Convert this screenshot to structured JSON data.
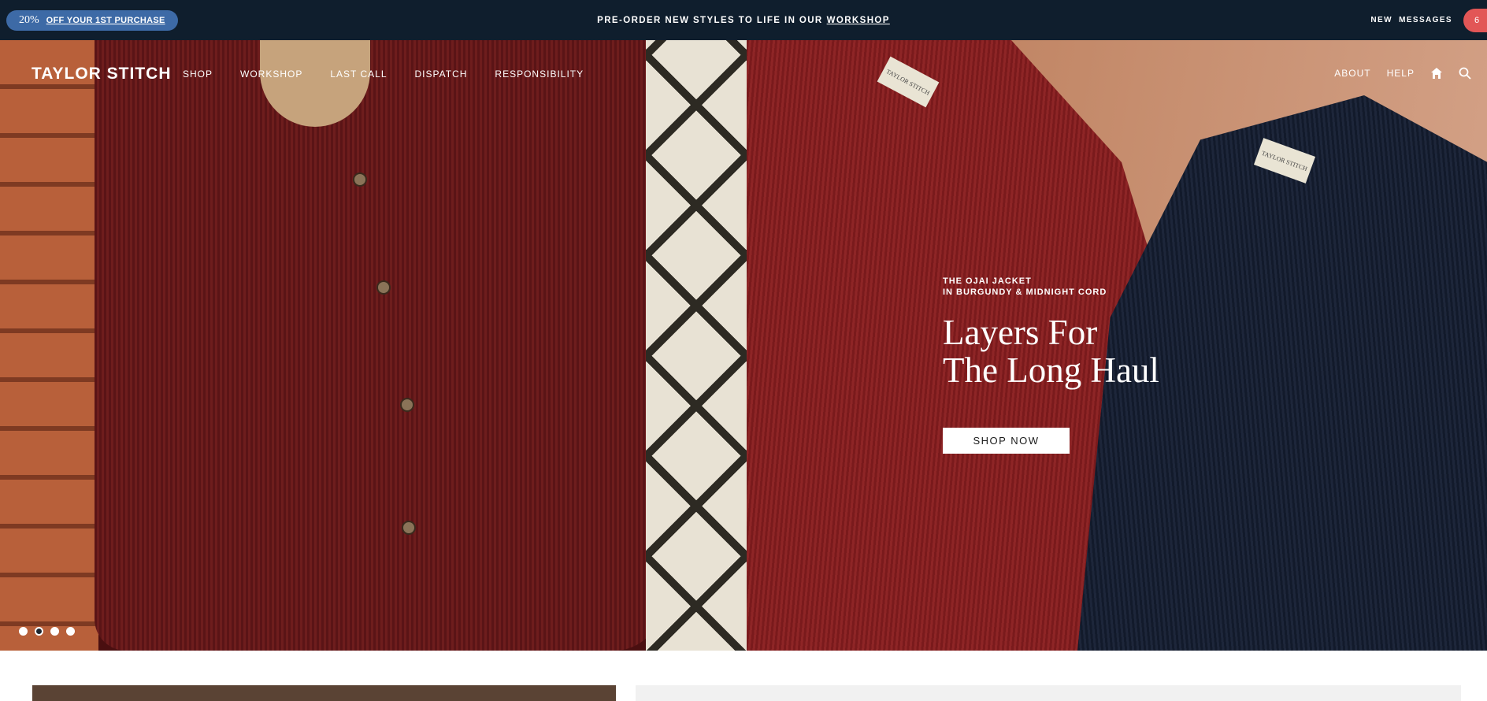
{
  "promo": {
    "percent": "20%",
    "label": "OFF YOUR 1ST PURCHASE"
  },
  "announcement": {
    "text": "PRE-ORDER NEW STYLES TO LIFE IN OUR",
    "link": "WORKSHOP"
  },
  "messages": {
    "label": "NEW MESSAGES",
    "count": "6"
  },
  "brand": {
    "logo": "TAYLOR STITCH"
  },
  "nav": {
    "items": [
      "SHOP",
      "WORKSHOP",
      "LAST CALL",
      "DISPATCH",
      "RESPONSIBILITY"
    ],
    "right": [
      "ABOUT",
      "HELP"
    ],
    "icons": [
      "home-icon",
      "search-icon"
    ]
  },
  "hero": {
    "eyebrow_line1": "THE OJAI JACKET",
    "eyebrow_line2": "IN BURGUNDY & MIDNIGHT CORD",
    "headline_line1": "Layers For",
    "headline_line2": "The Long Haul",
    "cta": "SHOP NOW",
    "slides": 4,
    "active_slide": 2
  },
  "colors": {
    "topbar": "#0f1e2d",
    "promo_pill": "#3d6aa6",
    "badge": "#e25656"
  }
}
